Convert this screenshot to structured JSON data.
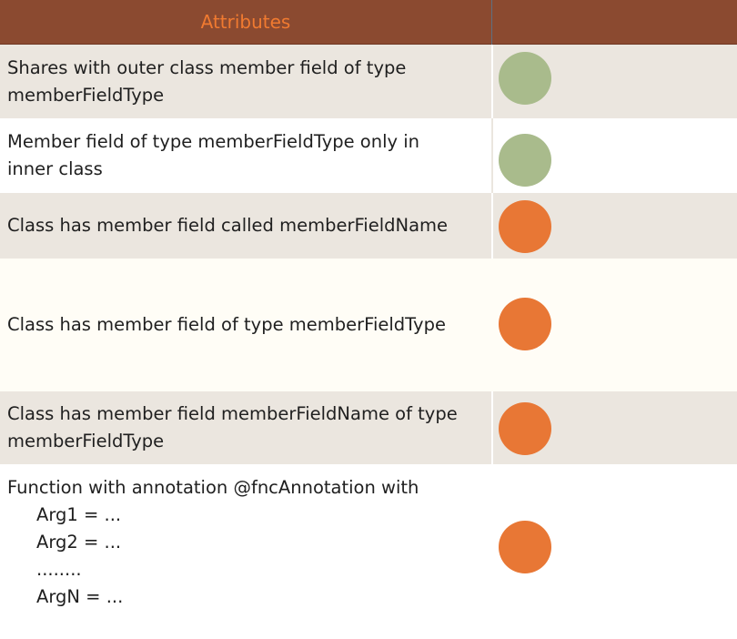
{
  "header": {
    "col1": "Attributes",
    "col2": ""
  },
  "colors": {
    "header_bg": "#8b4a30",
    "header_text": "#f07a30",
    "row_shaded": "#ebe6df",
    "row_white": "#ffffff",
    "row_cream": "#fffdf6",
    "dot_green": "#a9bb8c",
    "dot_orange": "#e87735"
  },
  "rows": [
    {
      "line1": "Shares with outer class member field of type",
      "line2": "memberFieldType",
      "dot": "green"
    },
    {
      "line1": "Member field of type memberFieldType only in",
      "line2": "inner class",
      "dot": "green"
    },
    {
      "line1": "Class has member field called memberFieldName",
      "dot": "orange"
    },
    {
      "line1": "Class has member field of type memberFieldType",
      "dot": "orange"
    },
    {
      "line1": "Class has member field memberFieldName of type",
      "line2": "memberFieldType",
      "dot": "orange"
    },
    {
      "line1": "Function with annotation @fncAnnotation with",
      "args": [
        "Arg1 = ...",
        "Arg2 = ...",
        "........",
        "ArgN = ..."
      ],
      "dot": "orange"
    }
  ]
}
